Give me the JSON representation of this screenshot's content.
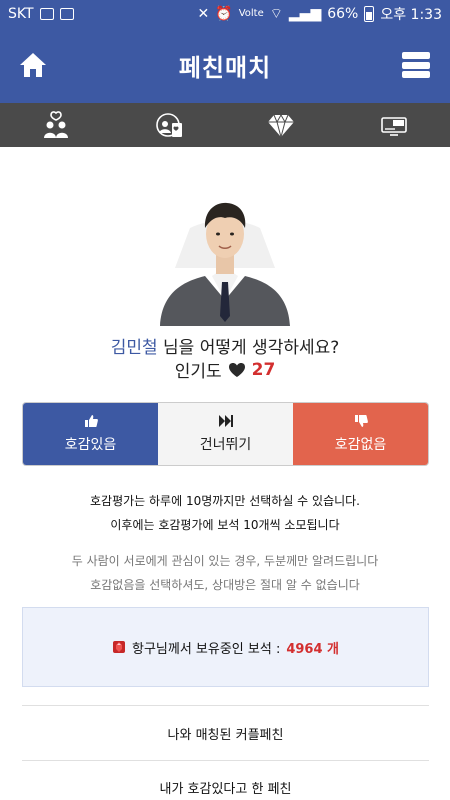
{
  "status_bar": {
    "carrier": "SKT",
    "signal_text": "Volte",
    "battery": "66%",
    "time": "오후 1:33"
  },
  "header": {
    "title": "페친매치",
    "home_icon": "home-icon",
    "menu_icon": "menu-icon"
  },
  "tabs": [
    {
      "icon": "couple-icon"
    },
    {
      "icon": "match-icon"
    },
    {
      "icon": "diamond-icon"
    },
    {
      "icon": "vip-icon"
    }
  ],
  "profile": {
    "name": "김민철",
    "question_suffix": " 님을 어떻게 생각하세요?",
    "popularity_label": "인기도",
    "popularity_count": "27"
  },
  "actions": {
    "like": "호감있음",
    "skip": "건너뛰기",
    "dislike": "호감없음"
  },
  "notices": {
    "line1": "호감평가는 하루에 10명까지만 선택하실 수 있습니다.",
    "line2": "이후에는 호감평가에 보석 10개씩 소모됩니다",
    "line3": "두 사람이 서로에게 관심이 있는 경우, 두분께만 알려드립니다",
    "line4": "호감없음을 선택하셔도, 상대방은 절대 알 수 없습니다"
  },
  "jewels": {
    "label": "항구님께서 보유중인 보석 :",
    "count": "4964 개"
  },
  "links": {
    "matched": "나와 매칭된 커플페친",
    "liked": "내가 호감있다고 한 페친"
  },
  "colors": {
    "brand": "#3d59a3",
    "tabbar": "#4a4a4a",
    "dislike": "#e2644d",
    "accent_red": "#d32f2f"
  }
}
